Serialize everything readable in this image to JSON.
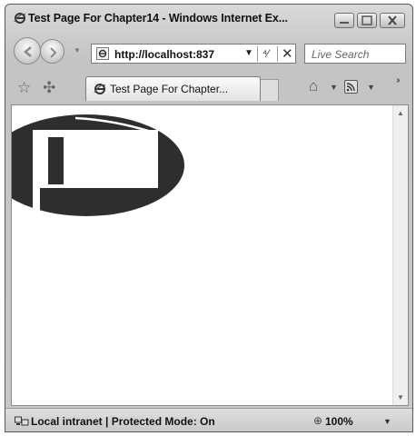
{
  "window": {
    "title": "Test Page For Chapter14 - Windows Internet Ex..."
  },
  "navbar": {
    "address": "http://localhost:837",
    "search_placeholder": "Live Search"
  },
  "tabbar": {
    "active_tab_title": "Test Page For Chapter..."
  },
  "statusbar": {
    "zone_text": "Local intranet | Protected Mode: On",
    "zoom": "100%"
  },
  "colors": {
    "chrome": "#c8c8c8",
    "page_background": "#ffffff",
    "ellipse_fill": "#2e2e2e"
  }
}
